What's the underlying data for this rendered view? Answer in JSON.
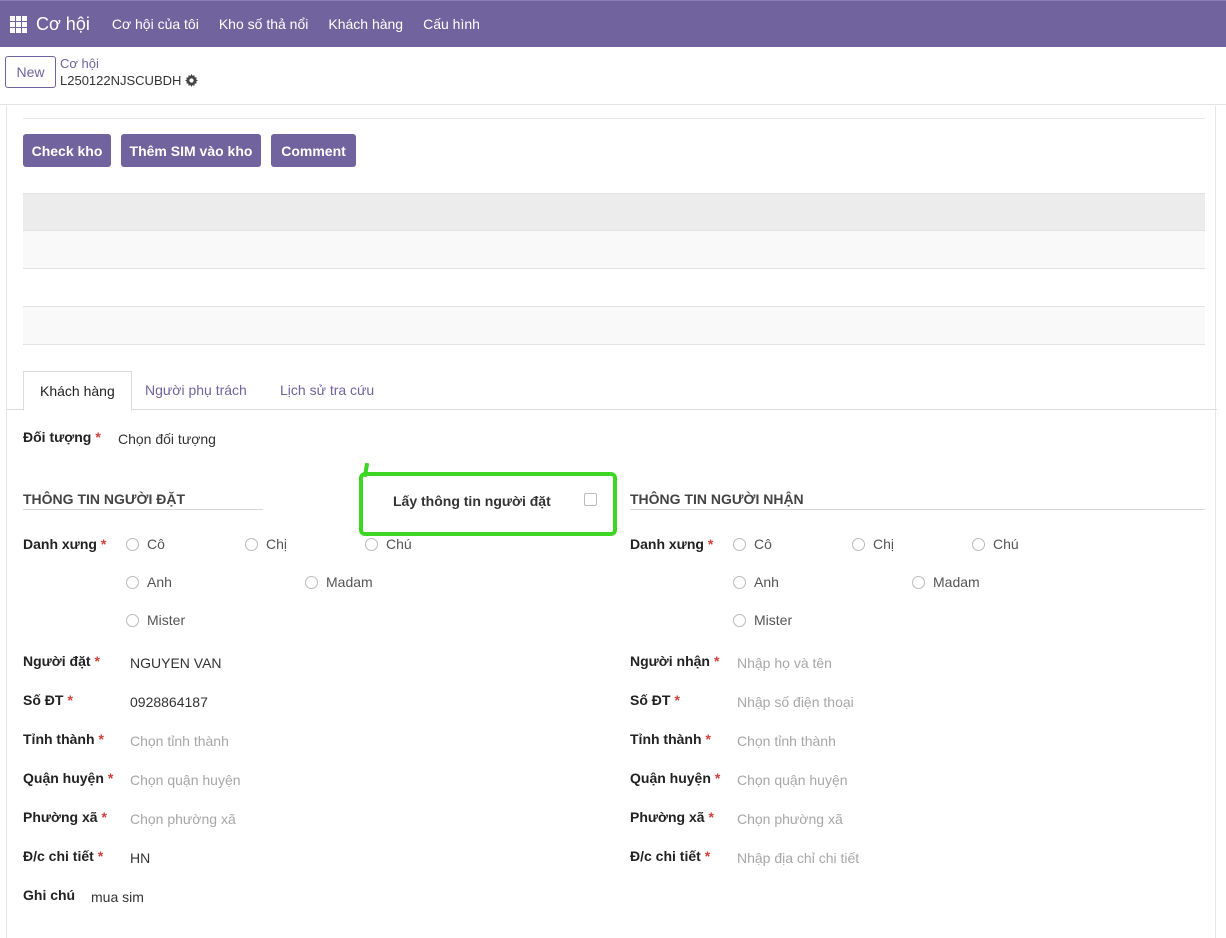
{
  "navbar": {
    "brand": "Cơ hội",
    "items": [
      "Cơ hội của tôi",
      "Kho số thả nổi",
      "Khách hàng",
      "Cấu hình"
    ]
  },
  "control": {
    "new_label": "New",
    "breadcrumb_parent": "Cơ hội",
    "breadcrumb_current": "L250122NJSCUBDH"
  },
  "actions": {
    "check_kho": "Check kho",
    "them_sim": "Thêm SIM vào kho",
    "comment": "Comment"
  },
  "tabs": [
    "Khách hàng",
    "Người phụ trách",
    "Lịch sử tra cứu"
  ],
  "doi_tuong": {
    "label": "Đối tượng",
    "placeholder": "Chọn đối tượng"
  },
  "copy_checkbox_label": "Lấy thông tin người đặt",
  "orderer": {
    "title": "THÔNG TIN NGƯỜI ĐẶT",
    "salutation_label": "Danh xưng",
    "salutations": [
      "Cô",
      "Chị",
      "Chú",
      "Anh",
      "Madam",
      "Mister"
    ],
    "name_label": "Người đặt",
    "name_value": "NGUYEN VAN",
    "phone_label": "Số ĐT",
    "phone_value": "0928864187",
    "province_label": "Tỉnh thành",
    "province_placeholder": "Chọn tỉnh thành",
    "district_label": "Quận huyện",
    "district_placeholder": "Chọn quận huyện",
    "ward_label": "Phường xã",
    "ward_placeholder": "Chọn phường xã",
    "address_label": "Đ/c chi tiết",
    "address_value": "HN",
    "note_label": "Ghi chú",
    "note_value": "mua sim"
  },
  "receiver": {
    "title": "THÔNG TIN NGƯỜI NHẬN",
    "salutation_label": "Danh xưng",
    "salutations": [
      "Cô",
      "Chị",
      "Chú",
      "Anh",
      "Madam",
      "Mister"
    ],
    "name_label": "Người nhận",
    "name_placeholder": "Nhập họ và tên",
    "phone_label": "Số ĐT",
    "phone_placeholder": "Nhập số điện thoại",
    "province_label": "Tỉnh thành",
    "province_placeholder": "Chọn tỉnh thành",
    "district_label": "Quận huyện",
    "district_placeholder": "Chọn quận huyện",
    "ward_label": "Phường xã",
    "ward_placeholder": "Chọn phường xã",
    "address_label": "Đ/c chi tiết",
    "address_placeholder": "Nhập địa chỉ chi tiết"
  },
  "required_mark": "*"
}
